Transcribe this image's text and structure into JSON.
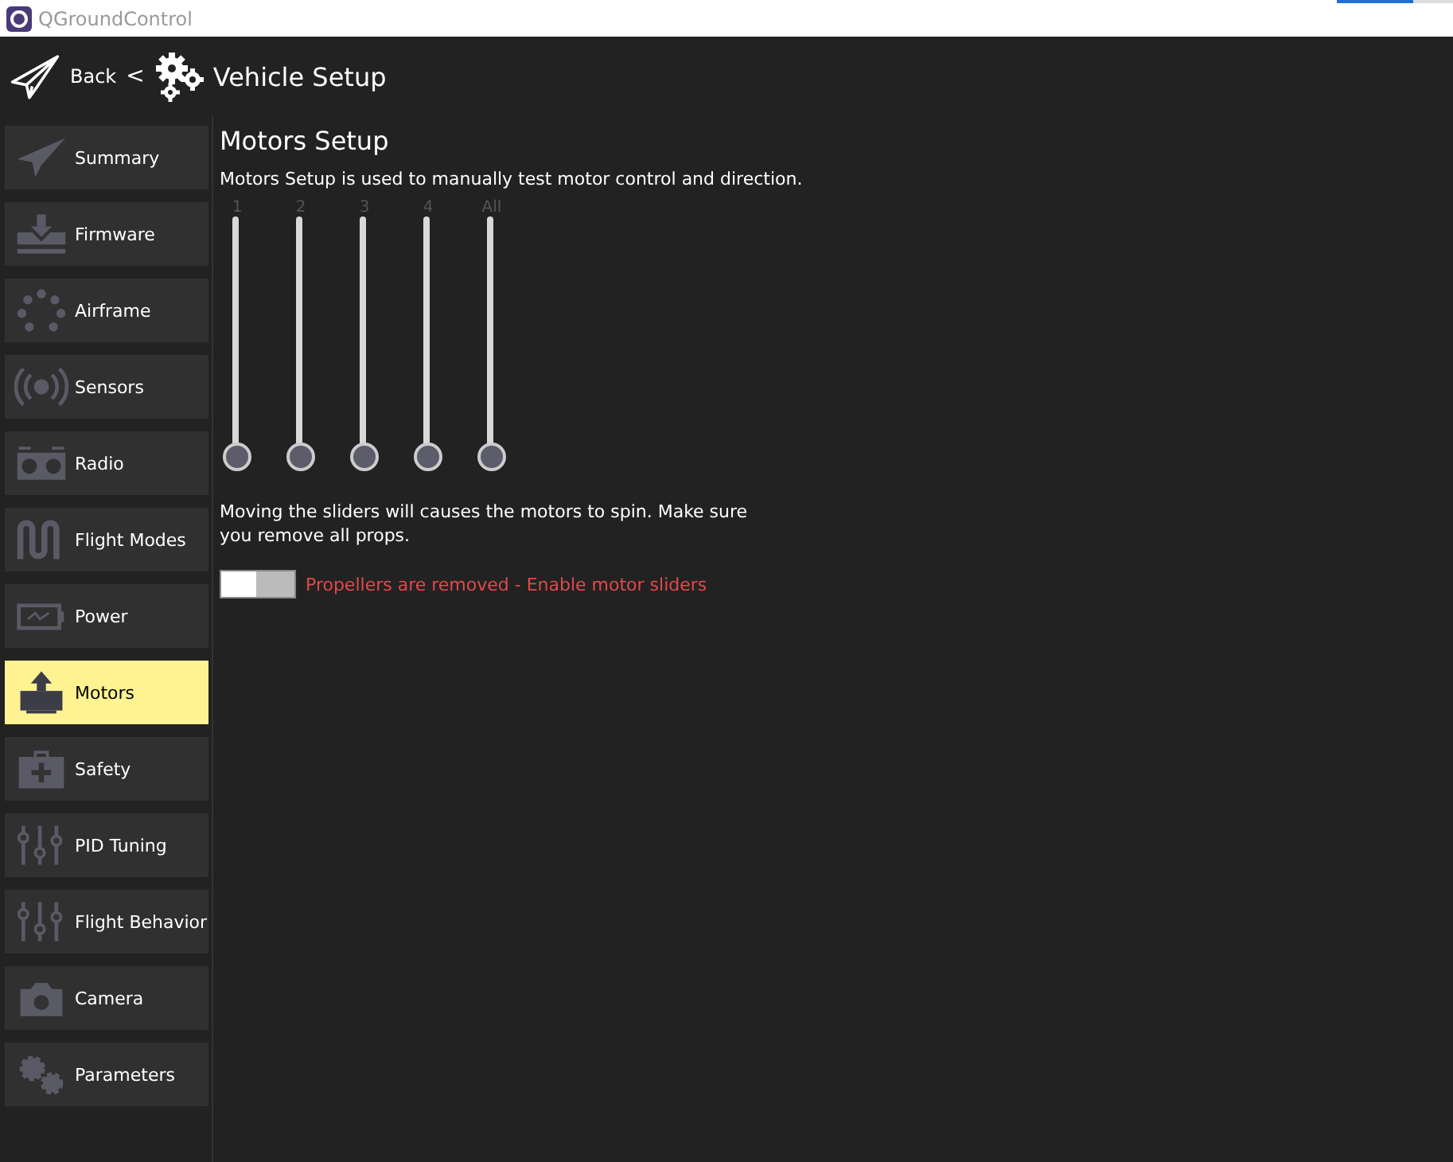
{
  "window": {
    "title": "QGroundControl",
    "progress": {
      "level": 0.66
    }
  },
  "toolbar": {
    "back": "Back",
    "separator": "<",
    "title": "Vehicle Setup"
  },
  "sidebar": {
    "items": [
      {
        "label": "Summary",
        "selected": false
      },
      {
        "label": "Firmware",
        "selected": false
      },
      {
        "label": "Airframe",
        "selected": false
      },
      {
        "label": "Sensors",
        "selected": false
      },
      {
        "label": "Radio",
        "selected": false
      },
      {
        "label": "Flight Modes",
        "selected": false
      },
      {
        "label": "Power",
        "selected": false
      },
      {
        "label": "Motors",
        "selected": true
      },
      {
        "label": "Safety",
        "selected": false
      },
      {
        "label": "PID Tuning",
        "selected": false
      },
      {
        "label": "Flight Behavior",
        "selected": false
      },
      {
        "label": "Camera",
        "selected": false
      },
      {
        "label": "Parameters",
        "selected": false
      }
    ]
  },
  "content": {
    "title": "Motors Setup",
    "description": "Motors Setup is used to manually test motor control and direction.",
    "sliders": [
      {
        "label": "1",
        "level": 0,
        "disabled": true
      },
      {
        "label": "2",
        "level": 0,
        "disabled": true
      },
      {
        "label": "3",
        "level": 0,
        "disabled": true
      },
      {
        "label": "4",
        "level": 0,
        "disabled": true
      },
      {
        "label": "All",
        "level": 0,
        "disabled": true
      }
    ],
    "warning": "Moving the sliders will causes the motors to spin. Make sure you remove all props.",
    "switch": {
      "checked": false,
      "label": "Propellers are removed - Enable motor sliders"
    }
  }
}
